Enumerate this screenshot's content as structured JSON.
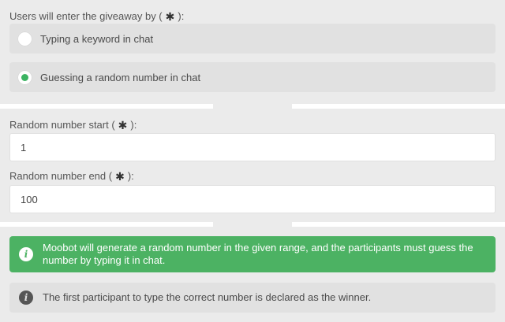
{
  "entry_method": {
    "label": "Users will enter the giveaway by (",
    "label_suffix": "):",
    "required_icon": "asterisk-icon",
    "options": [
      {
        "label": "Typing a keyword in chat",
        "selected": false
      },
      {
        "label": "Guessing a random number in chat",
        "selected": true
      }
    ]
  },
  "random_start": {
    "label": "Random number start (",
    "label_suffix": "):",
    "value": "1"
  },
  "random_end": {
    "label": "Random number end (",
    "label_suffix": "):",
    "value": "100"
  },
  "alerts": {
    "success": {
      "icon": "info-icon",
      "text": "Moobot will generate a random number in the given range, and the participants must guess the number by typing it in chat."
    },
    "info": {
      "icon": "info-icon",
      "text": "The first participant to type the correct number is declared as the winner."
    }
  },
  "colors": {
    "background": "#ebebeb",
    "accent_green": "#4cb263",
    "radio_selected": "#3cb462",
    "option_bg": "#e1e1e1"
  }
}
